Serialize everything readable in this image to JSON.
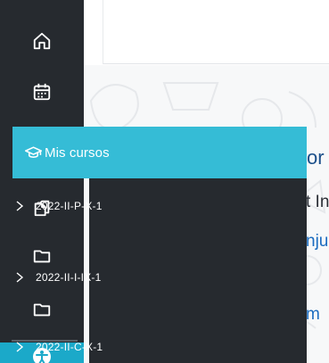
{
  "sidebar": {
    "icons": [
      {
        "name": "home-icon"
      },
      {
        "name": "calendar-icon"
      },
      {
        "name": "files-icon"
      },
      {
        "name": "folder-icon"
      },
      {
        "name": "folder-icon"
      },
      {
        "name": "accessibility-icon"
      }
    ],
    "active_color": "#1ba9c9"
  },
  "menu": {
    "highlighted": {
      "label": "Mis cursos",
      "icon": "graduation-cap-icon",
      "color": "#35bcd6"
    },
    "courses": [
      {
        "label": "2022-II-P-X-1"
      },
      {
        "label": "2022-II-I-IX-1"
      },
      {
        "label": "2022-II-C-X-1"
      }
    ]
  },
  "content": {
    "peek_1": "or",
    "peek_2": "t In",
    "peek_3": "nju",
    "peek_4": "m"
  },
  "colors": {
    "rail_bg": "#262a2f",
    "text_white": "#ffffff"
  }
}
